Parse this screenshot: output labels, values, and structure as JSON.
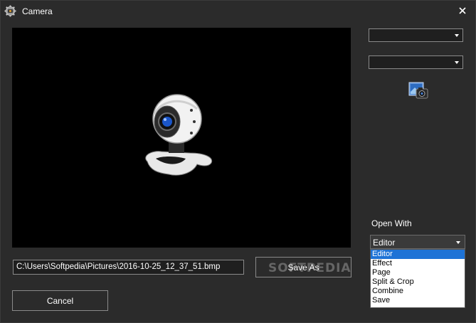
{
  "window": {
    "title": "Camera",
    "icons": {
      "app": "gear-camera-icon",
      "close": "close-icon"
    }
  },
  "preview": {
    "image": "webcam-icon"
  },
  "right_panel": {
    "device_combo": {
      "value": ""
    },
    "resolution_combo": {
      "value": ""
    },
    "capture_button_icon": "camera-capture-icon",
    "open_with": {
      "label": "Open With",
      "selected": "Editor",
      "options": [
        "Editor",
        "Effect",
        "Page",
        "Split & Crop",
        "Combine",
        "Save"
      ]
    }
  },
  "bottom": {
    "file_path": "C:\\Users\\Softpedia\\Pictures\\2016-10-25_12_37_51.bmp",
    "save_as_label": "Save As",
    "cancel_label": "Cancel",
    "watermark": "SOFTPEDIA"
  },
  "colors": {
    "background": "#2b2b2b",
    "preview_bg": "#000000",
    "selection": "#1e73d6"
  }
}
